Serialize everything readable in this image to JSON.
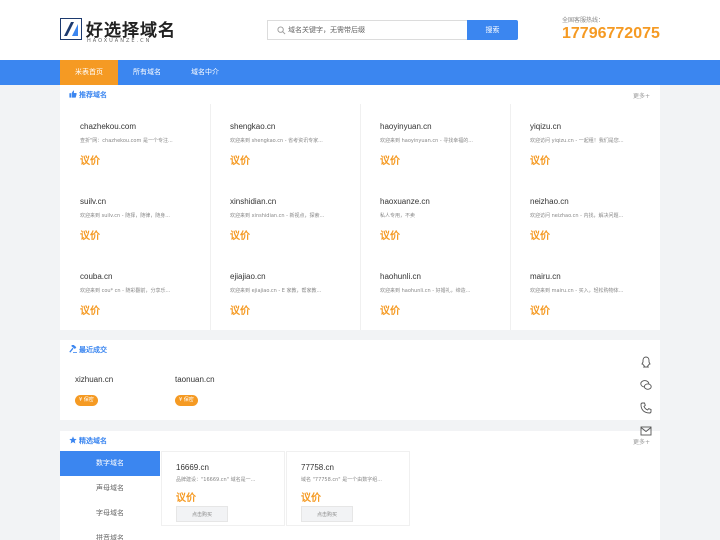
{
  "header": {
    "logo_cn": "好选择域名",
    "logo_en": "HAOXUANZE.CN",
    "search_placeholder": "域名关键字，无需带后缀",
    "search_button": "搜索",
    "hotline_label": "全国客服热线：",
    "hotline_number": "17796772075"
  },
  "nav": {
    "items": [
      {
        "label": "米表首页",
        "active": true
      },
      {
        "label": "所有域名",
        "active": false
      },
      {
        "label": "域名中介",
        "active": false
      }
    ]
  },
  "recommended": {
    "title": "推荐域名",
    "more": "更多+",
    "cards": [
      {
        "name": "chazhekou.com",
        "desc": "查折\"网：chazhekou.com 是一个专注...",
        "price": "议价"
      },
      {
        "name": "shengkao.cn",
        "desc": "欢迎来到 shengkao.cn - 省考资讯专家...",
        "price": "议价"
      },
      {
        "name": "haoyinyuan.cn",
        "desc": "欢迎来到 haoyinyuan.cn - 寻找幸福的...",
        "price": "议价"
      },
      {
        "name": "yiqizu.cn",
        "desc": "欢迎访问 yiqizu.cn - 一起租！我们是您...",
        "price": "议价"
      },
      {
        "name": "suilv.cn",
        "desc": "欢迎来到 suilv.cn - 随择，随律，随身...",
        "price": "议价"
      },
      {
        "name": "xinshidian.cn",
        "desc": "欢迎来到 xinshidian.cn - 新视点，探索...",
        "price": "议价"
      },
      {
        "name": "haoxuanze.cn",
        "desc": "私人专用，不卖",
        "price": "议价"
      },
      {
        "name": "neizhao.cn",
        "desc": "欢迎访问 neizhao.cn - 内找，解决问题...",
        "price": "议价"
      },
      {
        "name": "couba.cn",
        "desc": "欢迎来到 cou* cn - 随彩翻前，分享乐...",
        "price": "议价"
      },
      {
        "name": "ejiajiao.cn",
        "desc": "欢迎来到 ejiajiao.cn - E 家教，帮家教...",
        "price": "议价"
      },
      {
        "name": "haohunli.cn",
        "desc": "欢迎来到 haohunli.cn - 好婚礼，缔造...",
        "price": "议价"
      },
      {
        "name": "mairu.cn",
        "desc": "欢迎来到 mairu.cn - 买入，轻松购物体...",
        "price": "议价"
      }
    ]
  },
  "recent": {
    "title": "最近成交",
    "deals": [
      {
        "name": "xizhuan.cn",
        "badge": "¥ 保密"
      },
      {
        "name": "taonuan.cn",
        "badge": "¥ 保密"
      }
    ]
  },
  "selected": {
    "title": "精选域名",
    "more": "更多+",
    "tabs": [
      {
        "label": "数字域名",
        "active": true
      },
      {
        "label": "声母域名",
        "active": false
      },
      {
        "label": "字母域名",
        "active": false
      },
      {
        "label": "拼音域名",
        "active": false
      }
    ],
    "cards": [
      {
        "name": "16669.cn",
        "desc": "品牌建设：\"16669.cn\" 域名是一...",
        "price": "议价",
        "button": "点击购买"
      },
      {
        "name": "77758.cn",
        "desc": "域名 \"77758.cn\" 是一个由数字组...",
        "price": "议价",
        "button": "点击购买"
      }
    ]
  },
  "float_toolbar": {
    "items": [
      "qq-icon",
      "wechat-icon",
      "phone-icon",
      "mail-icon"
    ]
  },
  "colors": {
    "primary": "#3b86f0",
    "accent": "#f59a23"
  }
}
